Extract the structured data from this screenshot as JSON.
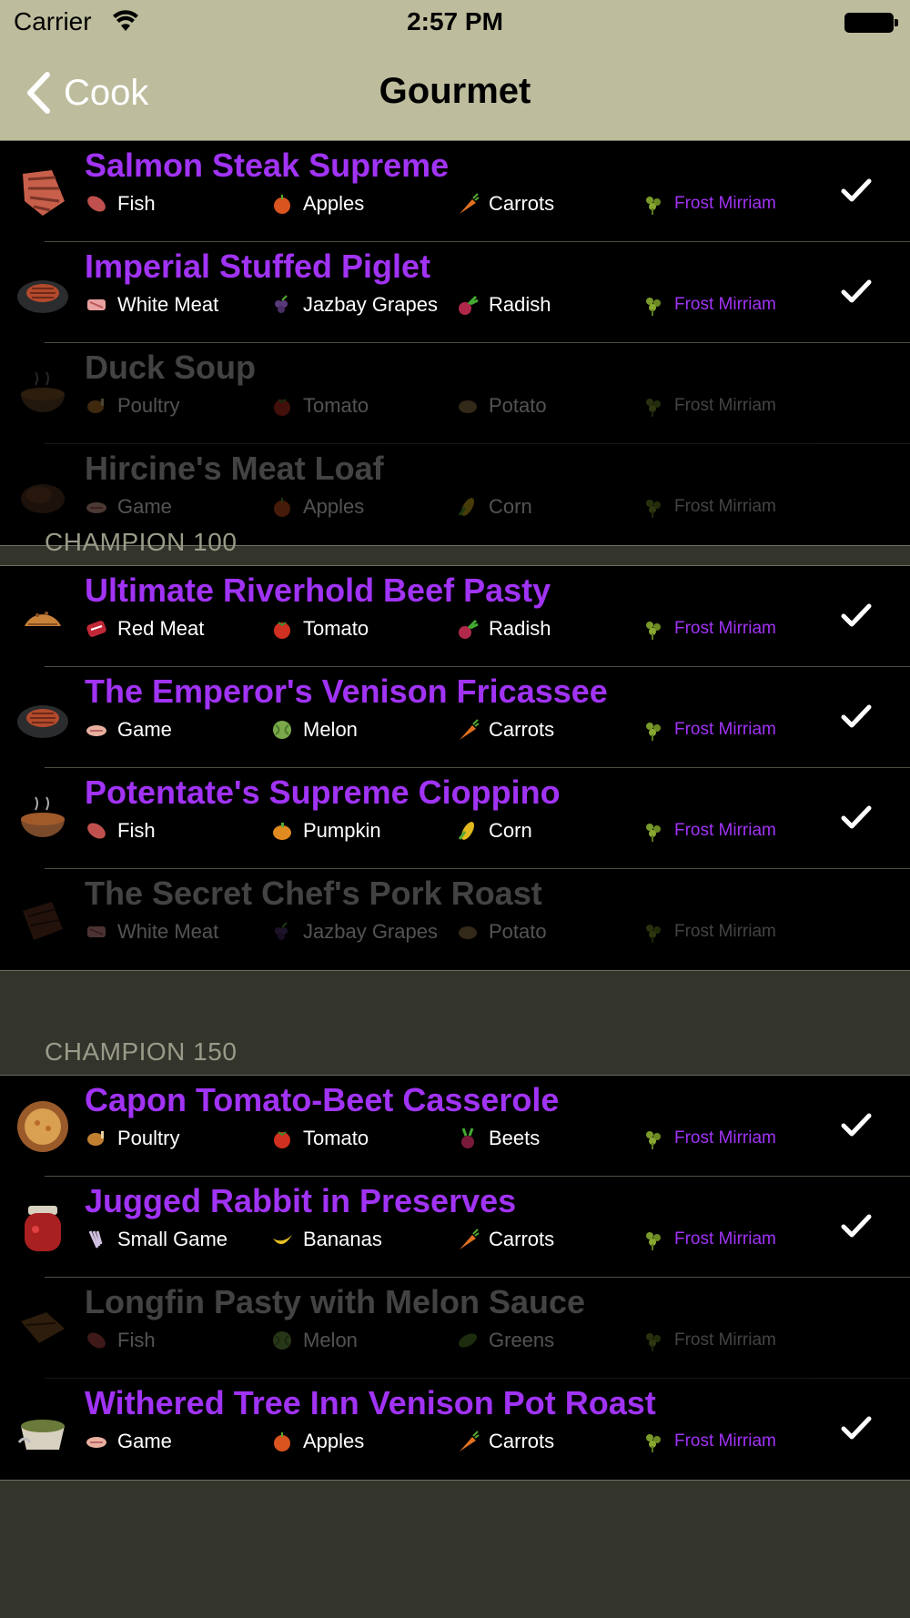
{
  "status": {
    "carrier": "Carrier",
    "time": "2:57 PM"
  },
  "nav": {
    "back_label": "Cook",
    "title": "Gourmet"
  },
  "colors": {
    "bar": "#bdbc9c",
    "accent": "#a133f5",
    "list_bg": "#000000",
    "grouped_bg": "#33342c"
  },
  "sections": [
    {
      "header": "",
      "recipes": [
        {
          "name": "Salmon Steak Supreme",
          "available": true,
          "image_icon": "salmon-steak-icon",
          "ingredients": [
            "Fish",
            "Apples",
            "Carrots",
            "Frost Mirriam"
          ]
        },
        {
          "name": "Imperial Stuffed Piglet",
          "available": true,
          "image_icon": "stuffed-piglet-icon",
          "ingredients": [
            "White Meat",
            "Jazbay Grapes",
            "Radish",
            "Frost Mirriam"
          ]
        },
        {
          "name": "Duck Soup",
          "available": false,
          "image_icon": "soup-bowl-icon",
          "ingredients": [
            "Poultry",
            "Tomato",
            "Potato",
            "Frost Mirriam"
          ]
        },
        {
          "name": "Hircine's Meat Loaf",
          "available": false,
          "image_icon": "meat-loaf-icon",
          "ingredients": [
            "Game",
            "Apples",
            "Corn",
            "Frost Mirriam"
          ]
        }
      ]
    },
    {
      "header": "CHAMPION 100",
      "recipes": [
        {
          "name": "Ultimate Riverhold Beef Pasty",
          "available": true,
          "image_icon": "pasty-icon",
          "ingredients": [
            "Red Meat",
            "Tomato",
            "Radish",
            "Frost Mirriam"
          ]
        },
        {
          "name": "The Emperor's Venison Fricassee",
          "available": true,
          "image_icon": "fricassee-icon",
          "ingredients": [
            "Game",
            "Melon",
            "Carrots",
            "Frost Mirriam"
          ]
        },
        {
          "name": "Potentate's Supreme Cioppino",
          "available": true,
          "image_icon": "cioppino-icon",
          "ingredients": [
            "Fish",
            "Pumpkin",
            "Corn",
            "Frost Mirriam"
          ]
        },
        {
          "name": "The Secret Chef's Pork Roast",
          "available": false,
          "image_icon": "pork-roast-icon",
          "ingredients": [
            "White Meat",
            "Jazbay Grapes",
            "Potato",
            "Frost Mirriam"
          ]
        }
      ]
    },
    {
      "header": "CHAMPION 150",
      "recipes": [
        {
          "name": "Capon Tomato-Beet Casserole",
          "available": true,
          "image_icon": "casserole-icon",
          "ingredients": [
            "Poultry",
            "Tomato",
            "Beets",
            "Frost Mirriam"
          ]
        },
        {
          "name": "Jugged Rabbit in Preserves",
          "available": true,
          "image_icon": "preserves-jar-icon",
          "ingredients": [
            "Small Game",
            "Bananas",
            "Carrots",
            "Frost Mirriam"
          ]
        },
        {
          "name": "Longfin Pasty with Melon Sauce",
          "available": false,
          "image_icon": "longfin-pasty-icon",
          "ingredients": [
            "Fish",
            "Melon",
            "Greens",
            "Frost Mirriam"
          ]
        },
        {
          "name": "Withered Tree Inn Venison Pot Roast",
          "available": true,
          "image_icon": "pot-roast-icon",
          "ingredients": [
            "Game",
            "Apples",
            "Carrots",
            "Frost Mirriam"
          ]
        }
      ]
    }
  ]
}
